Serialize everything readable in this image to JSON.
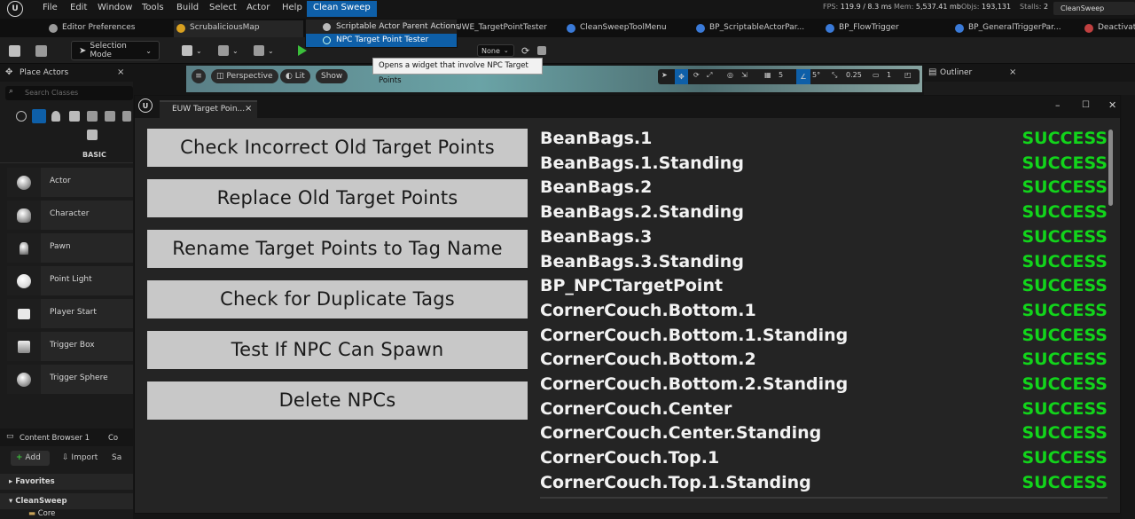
{
  "menu": {
    "items": [
      "File",
      "Edit",
      "Window",
      "Tools",
      "Build",
      "Select",
      "Actor",
      "Help"
    ],
    "active": "Clean Sweep"
  },
  "stats": {
    "fps_label": "FPS:",
    "fps": "119.9 / 8.3 ms",
    "mem_label": "Mem:",
    "mem": "5,537.41 mb",
    "objs_label": "Objs:",
    "objs": "193,131",
    "stalls_label": "Stalls:",
    "stalls": "2",
    "project": "CleanSweep"
  },
  "tabs": [
    {
      "label": "Editor Preferences",
      "color": "#9a9a9a"
    },
    {
      "label": "ScrubaliciousMap",
      "color": "#d8a020"
    },
    {
      "label": "UWE_TargetPointTester",
      "color": "#3a7ad8"
    },
    {
      "label": "CleanSweepToolMenu",
      "color": "#3a7ad8"
    },
    {
      "label": "BP_ScriptableActorPar...",
      "color": "#3a7ad8"
    },
    {
      "label": "BP_FlowTrigger",
      "color": "#3a7ad8"
    },
    {
      "label": "BP_GeneralTriggerPar...",
      "color": "#3a7ad8"
    },
    {
      "label": "Deactivate",
      "color": "#c04040"
    }
  ],
  "toolbar": {
    "selection_mode": "Selection Mode",
    "none_label": "None"
  },
  "dropdown": {
    "items": [
      {
        "label": "Scriptable Actor Parent Actions",
        "selected": false
      },
      {
        "label": "NPC Target Point Tester",
        "selected": true
      }
    ]
  },
  "tooltip": "Opens a widget that involve NPC Target Points",
  "place_actors": {
    "title": "Place Actors",
    "search_placeholder": "Search Classes",
    "category": "BASIC",
    "actors": [
      "Actor",
      "Character",
      "Pawn",
      "Point Light",
      "Player Start",
      "Trigger Box",
      "Trigger Sphere"
    ]
  },
  "content_browser": {
    "title": "Content Browser 1",
    "title2": "Co",
    "add_label": "Add",
    "import_label": "Import",
    "save_label": "Sa",
    "favorites": "Favorites",
    "root": "CleanSweep",
    "folder": "Core"
  },
  "viewport": {
    "perspective": "Perspective",
    "lit": "Lit",
    "show": "Show",
    "grid_value": "5",
    "angle_value": "5°",
    "scale_value": "0.25",
    "camera_speed": "1"
  },
  "outliner": {
    "title": "Outliner"
  },
  "widget": {
    "tab_label": "EUW Target Poin...",
    "buttons": [
      "Check Incorrect Old Target Points",
      "Replace Old Target Points",
      "Rename Target Points to Tag Name",
      "Check for Duplicate Tags",
      "Test If NPC Can Spawn",
      "Delete NPCs"
    ],
    "results": [
      {
        "name": "BeanBags.1",
        "status": "SUCCESS"
      },
      {
        "name": "BeanBags.1.Standing",
        "status": "SUCCESS"
      },
      {
        "name": "BeanBags.2",
        "status": "SUCCESS"
      },
      {
        "name": "BeanBags.2.Standing",
        "status": "SUCCESS"
      },
      {
        "name": "BeanBags.3",
        "status": "SUCCESS"
      },
      {
        "name": "BeanBags.3.Standing",
        "status": "SUCCESS"
      },
      {
        "name": "BP_NPCTargetPoint",
        "status": "SUCCESS"
      },
      {
        "name": "CornerCouch.Bottom.1",
        "status": "SUCCESS"
      },
      {
        "name": "CornerCouch.Bottom.1.Standing",
        "status": "SUCCESS"
      },
      {
        "name": "CornerCouch.Bottom.2",
        "status": "SUCCESS"
      },
      {
        "name": "CornerCouch.Bottom.2.Standing",
        "status": "SUCCESS"
      },
      {
        "name": "CornerCouch.Center",
        "status": "SUCCESS"
      },
      {
        "name": "CornerCouch.Center.Standing",
        "status": "SUCCESS"
      },
      {
        "name": "CornerCouch.Top.1",
        "status": "SUCCESS"
      },
      {
        "name": "CornerCouch.Top.1.Standing",
        "status": "SUCCESS"
      }
    ]
  }
}
